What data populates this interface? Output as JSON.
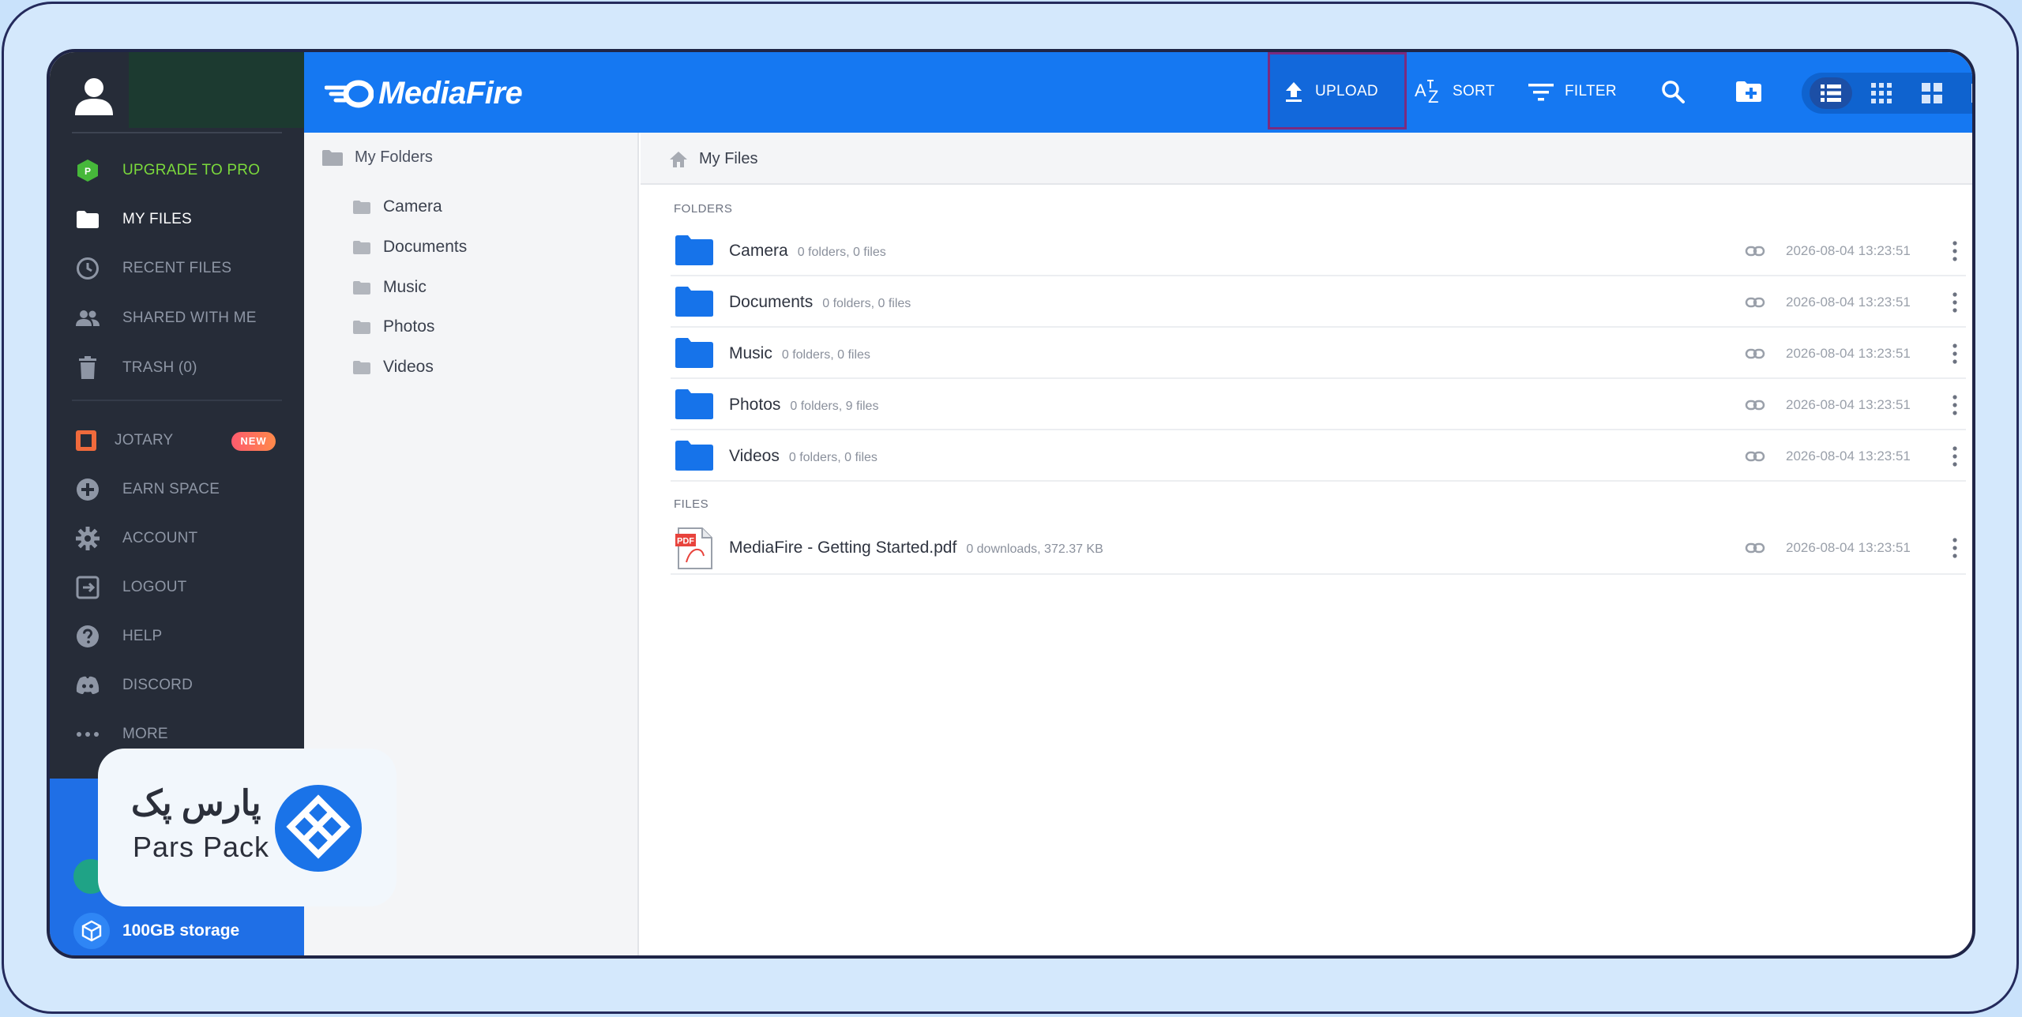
{
  "colors": {
    "accent": "#1578f2",
    "sidebar_bg": "#262c38",
    "upgrade_green": "#7bd93c",
    "folder_blue": "#1673ea",
    "upload_highlight": "#7b2b7f"
  },
  "header": {
    "logo": "MediaFire",
    "tools": {
      "upload": "UPLOAD",
      "sort": "SORT",
      "filter": "FILTER"
    },
    "icons": [
      "upload-icon",
      "sort-az-icon",
      "filter-icon",
      "search-icon",
      "new-folder-icon",
      "list-view-icon",
      "grid-small-icon",
      "grid-large-icon",
      "single-view-icon"
    ]
  },
  "sidebar": {
    "items": [
      {
        "label": "UPGRADE TO PRO",
        "icon": "pro-hex-icon"
      },
      {
        "label": "MY FILES",
        "icon": "folder-icon"
      },
      {
        "label": "RECENT FILES",
        "icon": "clock-icon"
      },
      {
        "label": "SHARED WITH ME",
        "icon": "people-icon"
      },
      {
        "label": "TRASH (0)",
        "icon": "trash-icon"
      },
      {
        "label": "JOTARY",
        "icon": "jotary-icon",
        "badge": "NEW"
      },
      {
        "label": "EARN SPACE",
        "icon": "plus-circle-icon"
      },
      {
        "label": "ACCOUNT",
        "icon": "gear-icon"
      },
      {
        "label": "LOGOUT",
        "icon": "logout-icon"
      },
      {
        "label": "HELP",
        "icon": "help-icon"
      },
      {
        "label": "DISCORD",
        "icon": "discord-icon"
      },
      {
        "label": "MORE",
        "icon": "more-dots-icon"
      }
    ],
    "storage": "100GB storage"
  },
  "tree": {
    "root": "My Folders",
    "items": [
      "Camera",
      "Documents",
      "Music",
      "Photos",
      "Videos"
    ]
  },
  "main": {
    "breadcrumb": "My Files",
    "folders_label": "FOLDERS",
    "files_label": "FILES",
    "folders": [
      {
        "name": "Camera",
        "meta": "0 folders, 0 files",
        "date": "2026-08-04 13:23:51"
      },
      {
        "name": "Documents",
        "meta": "0 folders, 0 files",
        "date": "2026-08-04 13:23:51"
      },
      {
        "name": "Music",
        "meta": "0 folders, 0 files",
        "date": "2026-08-04 13:23:51"
      },
      {
        "name": "Photos",
        "meta": "0 folders, 9 files",
        "date": "2026-08-04 13:23:51"
      },
      {
        "name": "Videos",
        "meta": "0 folders, 0 files",
        "date": "2026-08-04 13:23:51"
      }
    ],
    "files": [
      {
        "name": "MediaFire - Getting Started.pdf",
        "meta": "0 downloads, 372.37 KB",
        "date": "2026-08-04 13:23:51",
        "type_label": "PDF"
      }
    ]
  },
  "watermark": {
    "fa": "پارس پک",
    "en": "Pars Pack"
  }
}
